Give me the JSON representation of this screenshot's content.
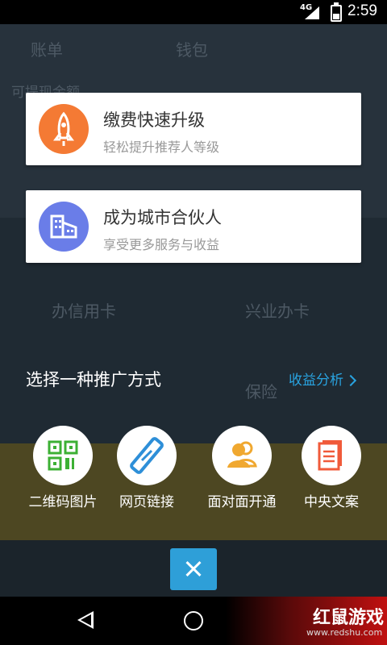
{
  "status_bar": {
    "network": "4G",
    "time": "2:59"
  },
  "background": {
    "header_left": "账单",
    "header_title": "钱包",
    "balance_label": "可提现金额",
    "item1_title": "办信用卡",
    "item2_title": "兴业办卡",
    "item3_title": "保险"
  },
  "cards": [
    {
      "title": "缴费快速升级",
      "subtitle": "轻松提升推荐人等级",
      "icon": "rocket-icon",
      "color": "#f47a34"
    },
    {
      "title": "成为城市合伙人",
      "subtitle": "享受更多服务与收益",
      "icon": "building-icon",
      "color": "#6a7de8"
    }
  ],
  "section": {
    "title": "选择一种推广方式",
    "link": "收益分析"
  },
  "options": [
    {
      "label": "二维码图片",
      "icon": "qrcode-icon",
      "color": "#3cb034"
    },
    {
      "label": "网页链接",
      "icon": "link-icon",
      "color": "#2e8fd8"
    },
    {
      "label": "面对面开通",
      "icon": "users-icon",
      "color": "#f0a830"
    },
    {
      "label": "中央文案",
      "icon": "document-icon",
      "color": "#f05a3a"
    }
  ],
  "watermark": {
    "text": "红鼠游戏",
    "url": "www.redshu.com"
  }
}
